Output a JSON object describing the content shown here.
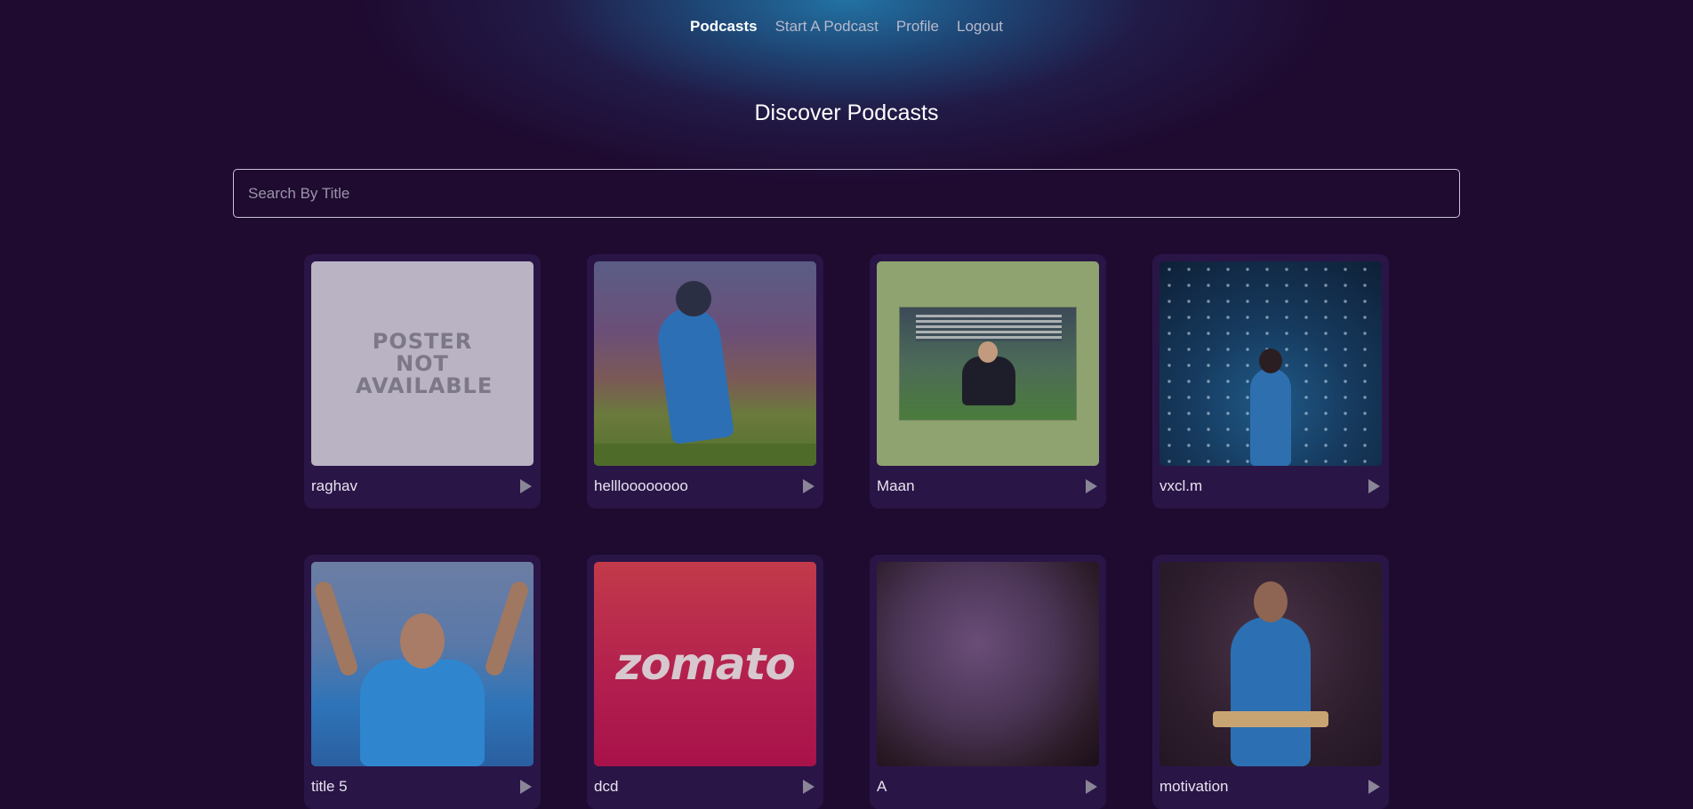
{
  "nav": {
    "items": [
      {
        "label": "Podcasts",
        "active": true
      },
      {
        "label": "Start A Podcast",
        "active": false
      },
      {
        "label": "Profile",
        "active": false
      },
      {
        "label": "Logout",
        "active": false
      }
    ]
  },
  "main": {
    "title": "Discover Podcasts",
    "search": {
      "placeholder": "Search By Title",
      "value": ""
    }
  },
  "podcasts": [
    {
      "title": "raghav",
      "thumb": "poster-not-available",
      "poster_text": "POSTER NOT AVAILABLE"
    },
    {
      "title": "hellloooooooo",
      "thumb": "cricketer-kneeling"
    },
    {
      "title": "Maan",
      "thumb": "man-sitting-on-grass"
    },
    {
      "title": "vxcl.m",
      "thumb": "cricketer-stadium-back"
    },
    {
      "title": "title 5",
      "thumb": "cricketer-celebrating"
    },
    {
      "title": "dcd",
      "thumb": "zomato-logo",
      "logo_text": "zomato"
    },
    {
      "title": "A",
      "thumb": "blurred-abstract"
    },
    {
      "title": "motivation",
      "thumb": "cricketer-with-bat"
    }
  ],
  "icons": {
    "play": "play-icon"
  },
  "colors": {
    "background": "#1f0a30",
    "card": "#2a1547",
    "glow": "#2278aa",
    "nav_active": "#ffffff",
    "nav_inactive": "#b7b9cc"
  }
}
